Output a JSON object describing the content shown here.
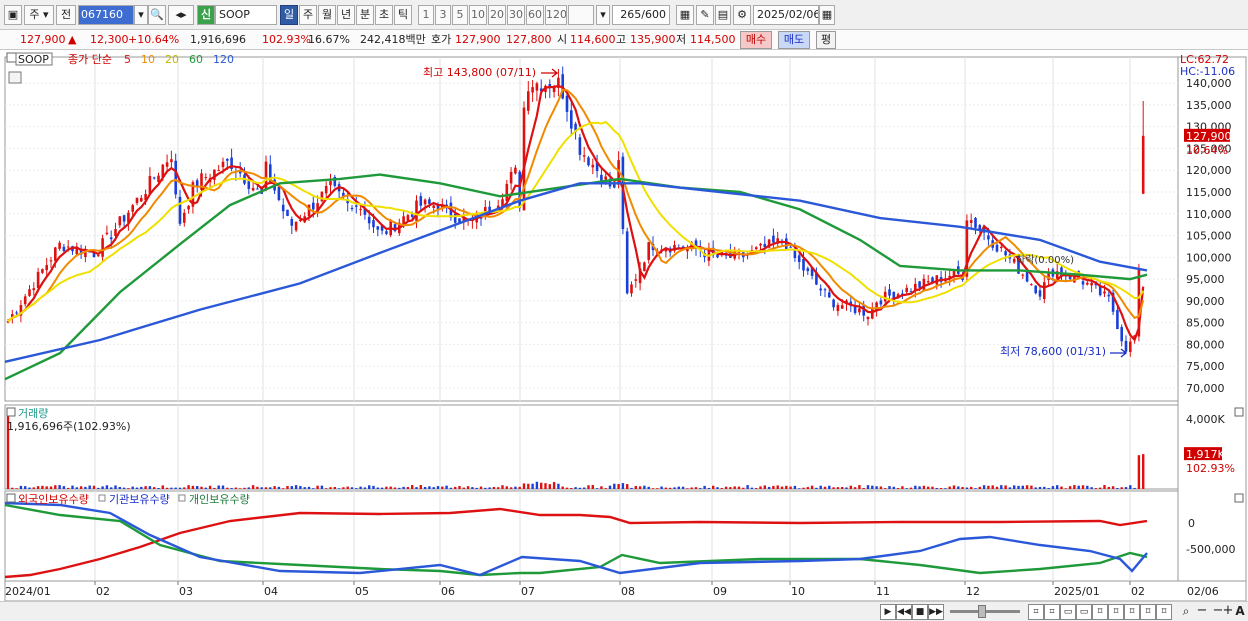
{
  "toolbar": {
    "period_code": "주",
    "prev_label": "전",
    "stock_code": "067160",
    "badge": "신",
    "stock_name": "SOOP",
    "tabs": [
      "일",
      "주",
      "월",
      "년",
      "분",
      "초",
      "틱"
    ],
    "active_tab": "일",
    "intervals": [
      "1",
      "3",
      "5",
      "10",
      "20",
      "30",
      "60",
      "120"
    ],
    "count": "265",
    "count_total": "/600",
    "date": "2025/02/06"
  },
  "quote": {
    "price": "127,900",
    "change": "12,300",
    "change_pct": "+10.64%",
    "volume": "1,916,696",
    "vol_ratio": "102.93%",
    "turnover": "16.67%",
    "amount": "242,418백만",
    "ask_label": "호가",
    "ask": "127,900",
    "bid": "127,800",
    "open_label": "시",
    "open": "114,600",
    "high_label": "고",
    "high": "135,900",
    "low_label": "저",
    "low": "114,500",
    "buy_label": "매수",
    "sell_label": "매도",
    "eval_label": "평"
  },
  "chart_labels": {
    "title": "SOOP",
    "ma_label": "종가 단순",
    "lc": "LC:62.72",
    "hc": "HC:-11.06",
    "high_note": "최고 143,800 (07/11)",
    "low_note": "최저 78,600 (01/31)",
    "mid_note": "하락(0.00%)",
    "last_price": "127,900",
    "last_pct": "10.64%",
    "volume_title": "거래량",
    "volume_info": "1,916,696주(102.93%)",
    "volume_last": "1,917K",
    "volume_last_pct": "102.93%",
    "flow_legend": [
      "외국인보유수량",
      "기관보유수량",
      "개인보유수량"
    ]
  },
  "chart_data": [
    {
      "type": "line",
      "title": "SOOP",
      "ma_periods": [
        "5",
        "10",
        "20",
        "60",
        "120"
      ],
      "colors": {
        "ma5": "#dd1111",
        "ma10": "#f08a00",
        "ma20": "#f0e000",
        "ma60": "#1f9a3a",
        "ma120": "#2a58d8",
        "up": "#e01010",
        "down": "#1a3fd8"
      },
      "x_tick_labels": [
        "2024/01",
        "02",
        "03",
        "04",
        "05",
        "06",
        "07",
        "08",
        "09",
        "10",
        "11",
        "12",
        "2025/01",
        "02",
        "02/06"
      ],
      "y_tick_labels": [
        "140,000",
        "135,000",
        "130,000",
        "125,000",
        "120,000",
        "115,000",
        "110,000",
        "105,000",
        "100,000",
        "95,000",
        "90,000",
        "85,000",
        "80,000",
        "75,000",
        "70,000"
      ],
      "ylim": [
        67000,
        146000
      ],
      "close_monthly": [
        {
          "month": "2024/01",
          "start": 85000,
          "end": 101000
        },
        {
          "month": "02",
          "end": 107000
        },
        {
          "month": "03",
          "end": 122000
        },
        {
          "month": "04",
          "end": 114000
        },
        {
          "month": "05",
          "end": 111000
        },
        {
          "month": "06",
          "end": 112000
        },
        {
          "month": "07",
          "end": 126000
        },
        {
          "month": "08",
          "end": 100000
        },
        {
          "month": "09",
          "end": 101000
        },
        {
          "month": "10",
          "end": 90000
        },
        {
          "month": "11",
          "end": 96000
        },
        {
          "month": "12",
          "end": 97000
        },
        {
          "month": "2025/01",
          "end": 80000
        },
        {
          "month": "02",
          "end": 127900
        }
      ],
      "high": {
        "value": 143800,
        "date": "07/11"
      },
      "low": {
        "value": 78600,
        "date": "01/31"
      }
    },
    {
      "type": "bar",
      "title": "거래량",
      "y_tick_labels": [
        "4,000K"
      ],
      "last_value": "1,917K"
    },
    {
      "type": "line",
      "series_names": [
        "외국인보유수량",
        "기관보유수량",
        "개인보유수량"
      ],
      "y_tick_labels": [
        "0",
        "-500,000"
      ],
      "colors": [
        "#dd1111",
        "#1f9a3a",
        "#2a58d8"
      ]
    }
  ]
}
